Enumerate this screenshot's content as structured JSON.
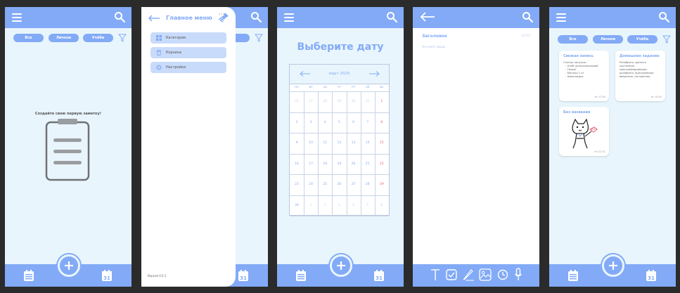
{
  "colors": {
    "accent": "#82aaf6",
    "background": "#e9f5fd",
    "frame": "#2b2b2b",
    "weekend": "#e5647e"
  },
  "filters": [
    "Все",
    "Личное",
    "Учёба"
  ],
  "empty_state": {
    "message": "Создайте свою первую заметку!"
  },
  "drawer": {
    "title": "Главное меню",
    "items": [
      {
        "label": "Категории",
        "icon": "grid-icon"
      },
      {
        "label": "Корзина",
        "icon": "trash-icon"
      },
      {
        "label": "Настройки",
        "icon": "gear-icon"
      }
    ],
    "version": "Версия 0.0.1"
  },
  "calendar": {
    "heading": "Выберите дату",
    "month": "март 2025",
    "weekdays": [
      "пн",
      "вт",
      "ср",
      "чт",
      "пт",
      "сб",
      "вс"
    ],
    "weeks": [
      [
        "24",
        "27",
        "28",
        "29",
        "30",
        "31",
        "1"
      ],
      [
        "2",
        "3",
        "4",
        "5",
        "6",
        "7",
        "8"
      ],
      [
        "9",
        "10",
        "11",
        "12",
        "13",
        "14",
        "15"
      ],
      [
        "16",
        "17",
        "18",
        "19",
        "20",
        "21",
        "22"
      ],
      [
        "23",
        "24",
        "25",
        "26",
        "27",
        "28",
        "29"
      ],
      [
        "30",
        "1",
        "2",
        "3",
        "4",
        "5",
        "6"
      ]
    ]
  },
  "editor": {
    "title_placeholder": "Заголовок",
    "time": "10:00",
    "body_placeholder": "Начните ввод"
  },
  "notes": [
    {
      "title": "Свежая запись",
      "lines": [
        "Список покупок:",
        "- Хлеб цельнозерновой",
        "- Творог",
        "- Молоко 1 кг",
        "- Шоколадка"
      ],
      "time": "вт 17:00"
    },
    {
      "title": "Домашнее задание",
      "lines": [
        "Разобрать сделать",
        "системное",
        "программирование,",
        "разобрать программное",
        "введение, алгоритмы"
      ],
      "time": "вт 10:00"
    },
    {
      "title": "Без названия",
      "time": "пн 22:01"
    }
  ],
  "bottom_bar": {
    "calendar_day": "31"
  }
}
